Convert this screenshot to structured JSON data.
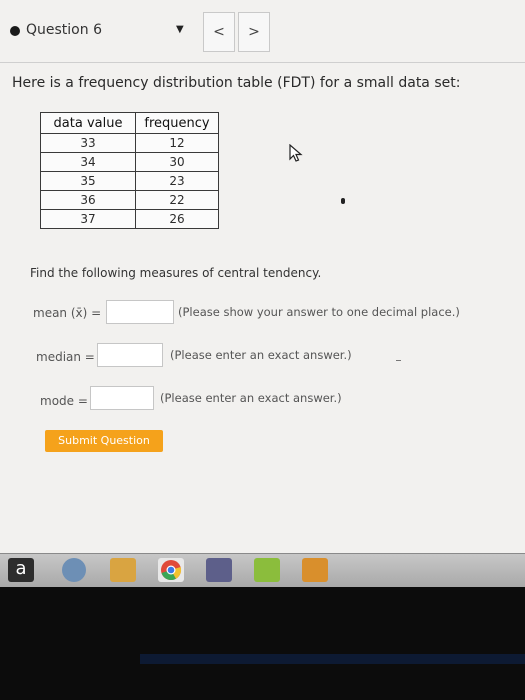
{
  "header": {
    "question_label": "Question 6",
    "dropdown_icon": "triangle-down-icon",
    "prev_label": "<",
    "next_label": ">"
  },
  "intro_text": "Here is a frequency distribution table (FDT) for a small data set:",
  "table": {
    "headers": [
      "data value",
      "frequency"
    ],
    "rows": [
      [
        "33",
        "12"
      ],
      [
        "34",
        "30"
      ],
      [
        "35",
        "23"
      ],
      [
        "36",
        "22"
      ],
      [
        "37",
        "26"
      ]
    ]
  },
  "find_text": "Find the following measures of central tendency.",
  "answers": {
    "mean": {
      "label": "mean (x̄) =",
      "value": "",
      "hint": "(Please show your answer to one decimal place.)"
    },
    "median": {
      "label": "median =",
      "value": "",
      "hint": "(Please enter an exact answer.)"
    },
    "mode": {
      "label": "mode =",
      "value": "",
      "hint": "(Please enter an exact answer.)"
    }
  },
  "submit_label": "Submit Question",
  "taskbar": {
    "icons": [
      "amazon-icon",
      "hp-icon",
      "photos-icon",
      "chrome-icon",
      "mcafee-icon",
      "pdf-icon",
      "word-icon"
    ]
  },
  "colors": {
    "accent": "#f5a21b",
    "screen_bg": "#f2f1ef"
  }
}
